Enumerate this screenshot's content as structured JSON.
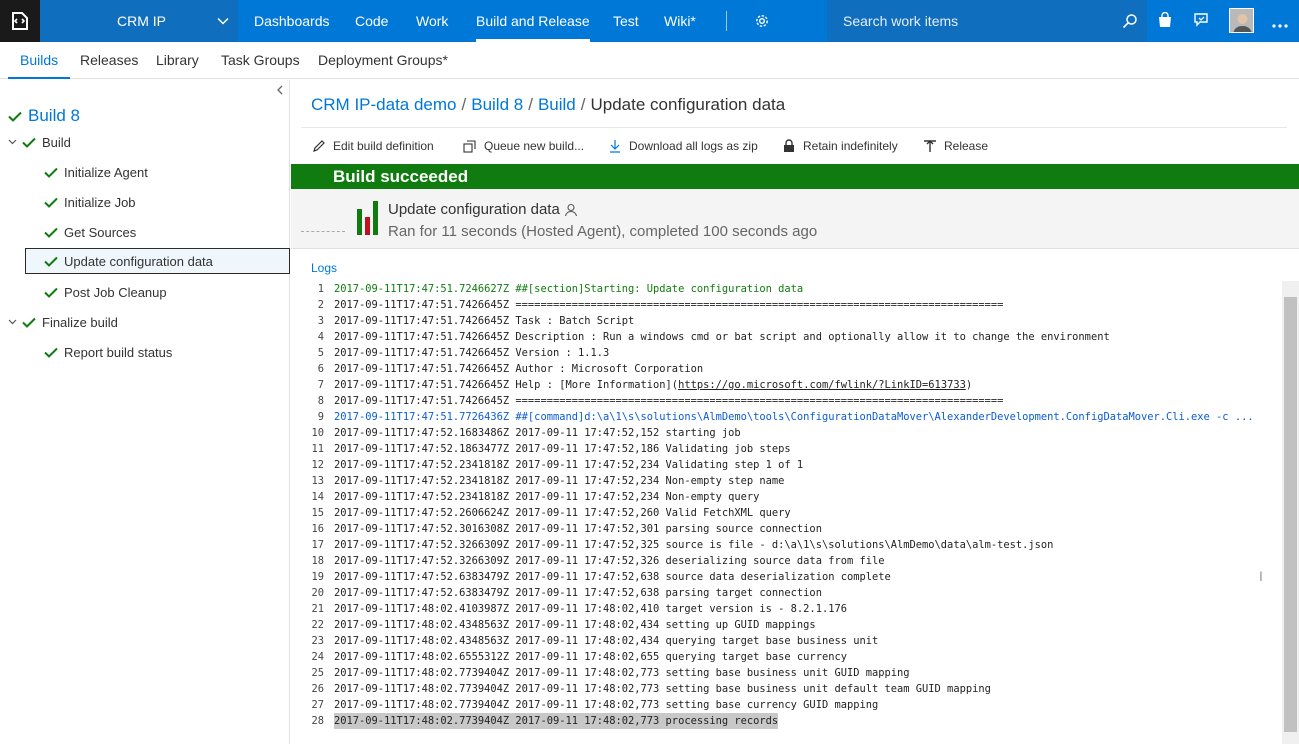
{
  "topbar": {
    "project_name": "CRM IP",
    "hubs": [
      "Dashboards",
      "Code",
      "Work",
      "Build and Release",
      "Test",
      "Wiki*"
    ],
    "selected_hub": "Build and Release",
    "search_placeholder": "Search work items",
    "accent": "#0078d7"
  },
  "subnav": {
    "tabs": [
      "Builds",
      "Releases",
      "Library",
      "Task Groups",
      "Deployment Groups*"
    ],
    "active": "Builds"
  },
  "sidebar": {
    "build_title": "Build 8",
    "items": [
      {
        "label": "Build"
      },
      {
        "label": "Initialize Agent"
      },
      {
        "label": "Initialize Job"
      },
      {
        "label": "Get Sources"
      },
      {
        "label": "Update configuration data"
      },
      {
        "label": "Post Job Cleanup"
      },
      {
        "label": "Finalize build"
      },
      {
        "label": "Report build status"
      }
    ]
  },
  "breadcrumb": {
    "items": [
      "CRM IP-data demo",
      "Build 8",
      "Build"
    ],
    "current": "Update configuration data"
  },
  "toolbar": {
    "edit": "Edit build definition",
    "queue": "Queue new build...",
    "download": "Download all logs as zip",
    "retain": "Retain indefinitely",
    "release": "Release"
  },
  "status": {
    "text": "Build succeeded",
    "color": "#107c10"
  },
  "summary": {
    "task": "Update configuration data",
    "detail": "Ran for 11 seconds (Hosted Agent), completed 100 seconds ago"
  },
  "logs": {
    "label": "Logs",
    "lines": [
      "2017-09-11T17:47:51.7246627Z ##[section]Starting: Update configuration data",
      "2017-09-11T17:47:51.7426645Z ==============================================================================",
      "2017-09-11T17:47:51.7426645Z Task         : Batch Script",
      "2017-09-11T17:47:51.7426645Z Description  : Run a windows cmd or bat script and optionally allow it to change the environment",
      "2017-09-11T17:47:51.7426645Z Version      : 1.1.3",
      "2017-09-11T17:47:51.7426645Z Author       : Microsoft Corporation",
      "2017-09-11T17:47:51.7426645Z Help         : [More Information](https://go.microsoft.com/fwlink/?LinkID=613733)",
      "2017-09-11T17:47:51.7426645Z ==============================================================================",
      "2017-09-11T17:47:51.7726436Z ##[command]d:\\a\\1\\s\\solutions\\AlmDemo\\tools\\ConfigurationDataMover\\AlexanderDevelopment.ConfigDataMover.Cli.exe -c ...",
      "2017-09-11T17:47:52.1683486Z 2017-09-11 17:47:52,152 starting job",
      "2017-09-11T17:47:52.1863477Z 2017-09-11 17:47:52,186 Validating job steps",
      "2017-09-11T17:47:52.2341818Z 2017-09-11 17:47:52,234   Validating step 1 of 1",
      "2017-09-11T17:47:52.2341818Z 2017-09-11 17:47:52,234     Non-empty step name",
      "2017-09-11T17:47:52.2341818Z 2017-09-11 17:47:52,234     Non-empty query",
      "2017-09-11T17:47:52.2606624Z 2017-09-11 17:47:52,260     Valid FetchXML query",
      "2017-09-11T17:47:52.3016308Z 2017-09-11 17:47:52,301 parsing source connection",
      "2017-09-11T17:47:52.3266309Z 2017-09-11 17:47:52,325 source is file - d:\\a\\1\\s\\solutions\\AlmDemo\\data\\alm-test.json",
      "2017-09-11T17:47:52.3266309Z 2017-09-11 17:47:52,326   deserializing source data from file",
      "2017-09-11T17:47:52.6383479Z 2017-09-11 17:47:52,638   source data deserialization complete",
      "2017-09-11T17:47:52.6383479Z 2017-09-11 17:47:52,638 parsing target connection",
      "2017-09-11T17:48:02.4103987Z 2017-09-11 17:48:02,410 target version is - 8.2.1.176",
      "2017-09-11T17:48:02.4348563Z 2017-09-11 17:48:02,434 setting up GUID mappings",
      "2017-09-11T17:48:02.4348563Z 2017-09-11 17:48:02,434 querying target base business unit",
      "2017-09-11T17:48:02.6555312Z 2017-09-11 17:48:02,655 querying target base currency",
      "2017-09-11T17:48:02.7739404Z 2017-09-11 17:48:02,773 setting base business unit GUID mapping",
      "2017-09-11T17:48:02.7739404Z 2017-09-11 17:48:02,773 setting base business unit default team GUID mapping",
      "2017-09-11T17:48:02.7739404Z 2017-09-11 17:48:02,773 setting base currency GUID mapping",
      "2017-09-11T17:48:02.7739404Z 2017-09-11 17:48:02,773 processing records"
    ]
  }
}
